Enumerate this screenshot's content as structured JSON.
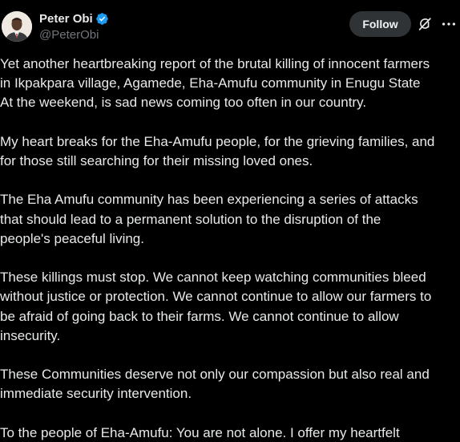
{
  "author": {
    "display_name": "Peter Obi",
    "handle": "@PeterObi",
    "verified": true
  },
  "actions": {
    "follow_label": "Follow",
    "grok_icon": "grok-icon",
    "more_icon": "more-options-icon"
  },
  "colors": {
    "background": "#000000",
    "text": "#e7e9ea",
    "handle": "#71767b",
    "verified": "#1d9bf0",
    "follow_bg": "#2f3336"
  },
  "post": {
    "paragraphs": [
      "Yet another heartbreaking report of the brutal killing of innocent farmers\nin Ikpakpara village, Agamede, Eha-Amufu community in Enugu State\nAt the weekend, is sad news coming too often in our country.",
      "My heart breaks for the Eha-Amufu people, for the grieving families, and\nfor those still searching for their missing loved ones.",
      "The Eha Amufu community has been experiencing a series of attacks\nthat should lead to a permanent solution to the disruption of the\npeople's peaceful living.",
      "These killings must stop. We cannot keep watching communities bleed\nwithout justice or protection. We cannot continue to allow our farmers to\nbe afraid of going back to their farms. We cannot continue to allow\ninsecurity.",
      "These Communities deserve not only our compassion but also real and\nimmediate security intervention.",
      "To the people of Eha-Amufu: You are not alone. I offer my heartfelt"
    ]
  }
}
